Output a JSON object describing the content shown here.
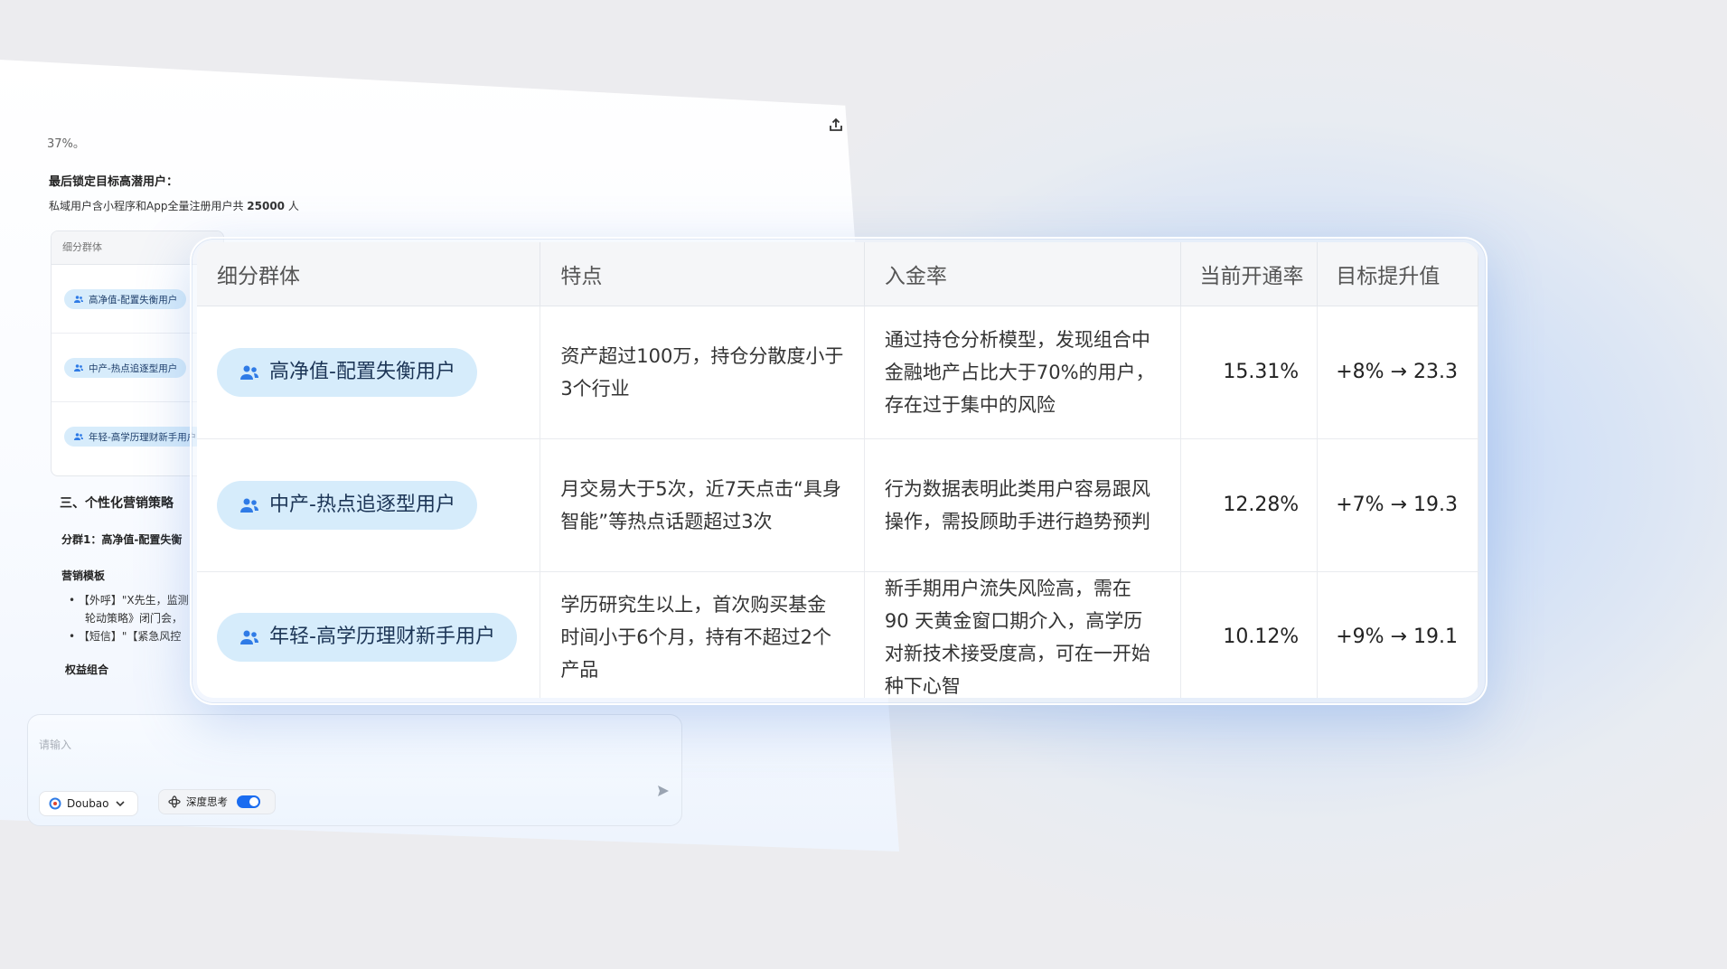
{
  "background_chat": {
    "faded_text": "37%。",
    "heading": "最后锁定目标高潜用户：",
    "summary_prefix": "私域用户含小程序和App全量注册用户共",
    "summary_count": "25000",
    "summary_unit": "人",
    "mini_table_header": "细分群体",
    "mini_groups": [
      "高净值-配置失衡用户",
      "中产-热点追逐型用户",
      "年轻-高学历理财新手用户"
    ],
    "section_title": "三、个性化营销策略",
    "subsection": "分群1：高净值-配置失衡",
    "template_label": "营销模板",
    "bullets": [
      "【外呼】\"X先生，监测",
      "轮动策略》闭门会，",
      "【短信】\"【紧急风控"
    ],
    "equity_label": "权益组合"
  },
  "input_bar": {
    "placeholder": "请输入",
    "model": "Doubao",
    "deep_think": "深度思考",
    "deep_think_on": true
  },
  "table": {
    "headers": [
      "细分群体",
      "特点",
      "入金率",
      "当前开通率",
      "目标提升值"
    ],
    "rows": [
      {
        "group": "高净值-配置失衡用户",
        "feature": "资产超过100万，持仓分散度小于3个行业",
        "deposit": "通过持仓分析模型，发现组合中金融地产占比大于70%的用户，存在过于集中的风险",
        "rate": "15.31%",
        "target": "+8% → 23.3"
      },
      {
        "group": "中产-热点追逐型用户",
        "feature": "月交易大于5次，近7天点击“具身智能”等热点话题超过3次",
        "deposit": "行为数据表明此类用户容易跟风操作，需投顾助手进行趋势预判",
        "rate": "12.28%",
        "target": "+7% → 19.3"
      },
      {
        "group": "年轻-高学历理财新手用户",
        "feature": "学历研究生以上，首次购买基金时间小于6个月，持有不超过2个产品",
        "deposit": "新手期用户流失风险高，需在 90 天黄金窗口期介入，高学历对新技术接受度高，可在一开始种下心智",
        "rate": "10.12%",
        "target": "+9% → 19.1"
      }
    ]
  },
  "colors": {
    "pill_bg": "#d6ecfb",
    "accent": "#1a6cf0",
    "icon_blue": "#2f7be6"
  }
}
